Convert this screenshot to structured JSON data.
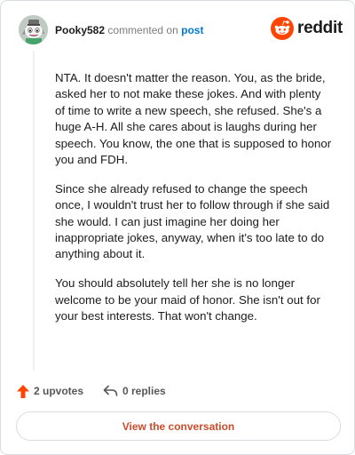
{
  "comment": {
    "username": "Pooky582",
    "action_text": "commented on",
    "post_link": "post",
    "paragraphs": [
      "NTA. It doesn't matter the reason. You, as the bride, asked her to not make these jokes. And with plenty of time to write a new speech, she refused. She's a huge A-H. All she cares about is laughs during her speech. You know, the one that is supposed to honor you and FDH.",
      "Since she already refused to change the speech once, I wouldn't trust her to follow through if she said she would. I can just imagine her doing her inappropriate jokes, anyway, when it's too late to do anything about it.",
      "You should absolutely tell her she is no longer welcome to be your maid of honor. She isn't out for your best interests. That won't change."
    ]
  },
  "brand": {
    "name": "reddit",
    "icon": "reddit-snoo-icon",
    "color": "#ff4500"
  },
  "actions": {
    "upvotes_label": "2 upvotes",
    "upvote_icon": "upvote-arrow-icon",
    "upvote_color": "#ff4500",
    "replies_label": "0 replies",
    "reply_icon": "reply-arrow-icon"
  },
  "footer": {
    "view_button_label": "View the conversation",
    "button_text_color": "#cc4b2a"
  }
}
